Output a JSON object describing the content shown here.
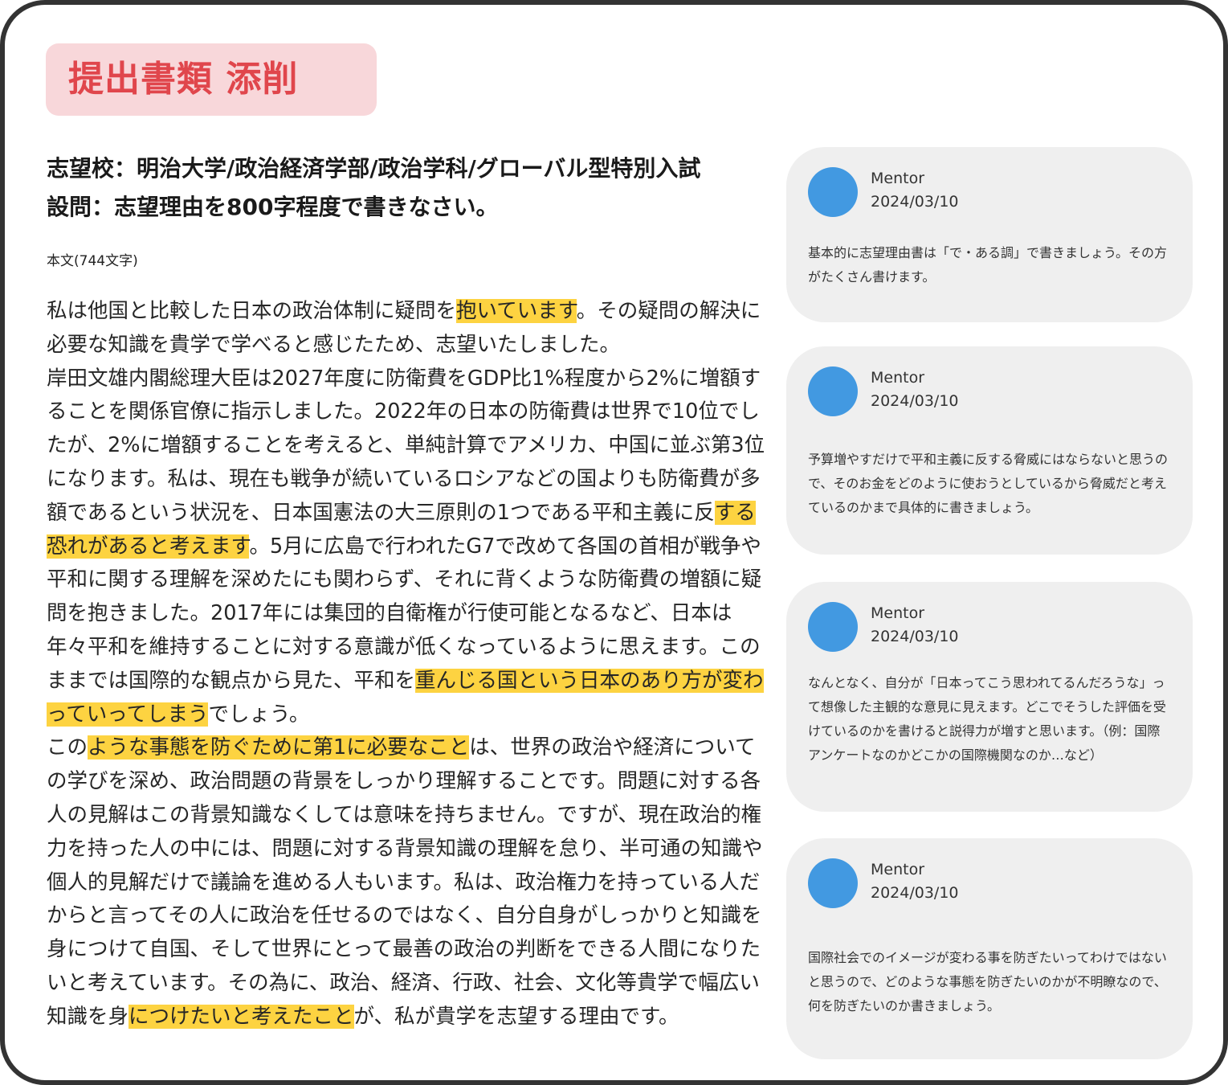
{
  "header": {
    "title": "提出書類 添削"
  },
  "submission": {
    "school": "志望校：明治大学/政治経済学部/政治学科/グローバル型特別入試",
    "question": "設問：志望理由を800字程度で書きなさい。",
    "char_count": "本文(744文字)"
  },
  "essay": {
    "p1": [
      {
        "text": "私は他国と比較した日本の政治体制に疑問を",
        "hl": false
      },
      {
        "text": "抱いています",
        "hl": true
      },
      {
        "text": "。その疑問の解決に必要な知識を貴学で学べると感じたため、志望いたしました。",
        "hl": false
      }
    ],
    "p2": [
      {
        "text": "岸田文雄内閣総理大臣は2027年度に防衛費をGDP比1%程度から2%に増額することを関係官僚に指示しました。2022年の日本の防衛費は世界で10位でしたが、2%に増額することを考えると、単純計算でアメリカ、中国に並ぶ第3位になります。私は、現在も戦争が続いているロシアなどの国よりも防衛費が多額であるという状況を、日本国憲法の大三原則の1つである平和主義に反",
        "hl": false
      },
      {
        "text": "する恐れがあると考えます",
        "hl": true
      },
      {
        "text": "。5月に広島で行われたG7で改めて各国の首相が戦争や平和に関する理解を深めたにも関わらず、それに背くような防衛費の増額に疑問を抱きました。2017年には集団的自衛権が行使可能となるなど、日本は年々平和を維持することに対する意識が低くなっているように思えます。このままでは国際的な観点から見た、平和を",
        "hl": false
      },
      {
        "text": "重んじる国という日本のあり方が変わっていってしまう",
        "hl": true
      },
      {
        "text": "でしょう。",
        "hl": false
      }
    ],
    "p3": [
      {
        "text": "この",
        "hl": false
      },
      {
        "text": "ような事態を防ぐために第1に必要なこと",
        "hl": true
      },
      {
        "text": "は、世界の政治や経済についての学びを深め、政治問題の背景をしっかり理解することです。問題に対する各人の見解はこの背景知識なくしては意味を持ちません。ですが、現在政治的権力を持った人の中には、問題に対する背景知識の理解を怠り、半可通の知識や個人的見解だけで議論を進める人もいます。私は、政治権力を持っている人だからと言ってその人に政治を任せるのではなく、自分自身がしっかりと知識を身につけて自国、そして世界にとって最善の政治の判断をできる人間になりたいと考えています。その為に、政治、経済、行政、社会、文化等貴学で幅広い知識を身",
        "hl": false
      },
      {
        "text": "につけたいと考えたこと",
        "hl": true
      },
      {
        "text": "が、私が貴学を志望する理由です。",
        "hl": false
      }
    ]
  },
  "comments": [
    {
      "author": "Mentor",
      "date": "2024/03/10",
      "body": "基本的に志望理由書は「で・ある調」で書きましょう。その方がたくさん書けます。"
    },
    {
      "author": "Mentor",
      "date": "2024/03/10",
      "body": "予算増やすだけで平和主義に反する脅威にはならないと思うので、そのお金をどのように使おうとしているから脅威だと考えているのかまで具体的に書きましょう。"
    },
    {
      "author": "Mentor",
      "date": "2024/03/10",
      "body": "なんとなく、自分が「日本ってこう思われてるんだろうな」って想像した主観的な意見に見えます。どこでそうした評価を受けているのかを書けると説得力が増すと思います。（例：国際アンケートなのかどこかの国際機関なのか…など）"
    },
    {
      "author": "Mentor",
      "date": "2024/03/10",
      "body": "国際社会でのイメージが変わる事を防ぎたいってわけではないと思うので、どのような事態を防ぎたいのかが不明瞭なので、何を防ぎたいのか書きましょう。"
    }
  ],
  "colors": {
    "title_badge_bg": "#f8d7da",
    "title_text": "#e0464c",
    "highlight": "#fdd341",
    "avatar": "#4299e1",
    "comment_card_bg": "#efefef"
  },
  "icons": {
    "avatar": "mentor-avatar-icon"
  }
}
